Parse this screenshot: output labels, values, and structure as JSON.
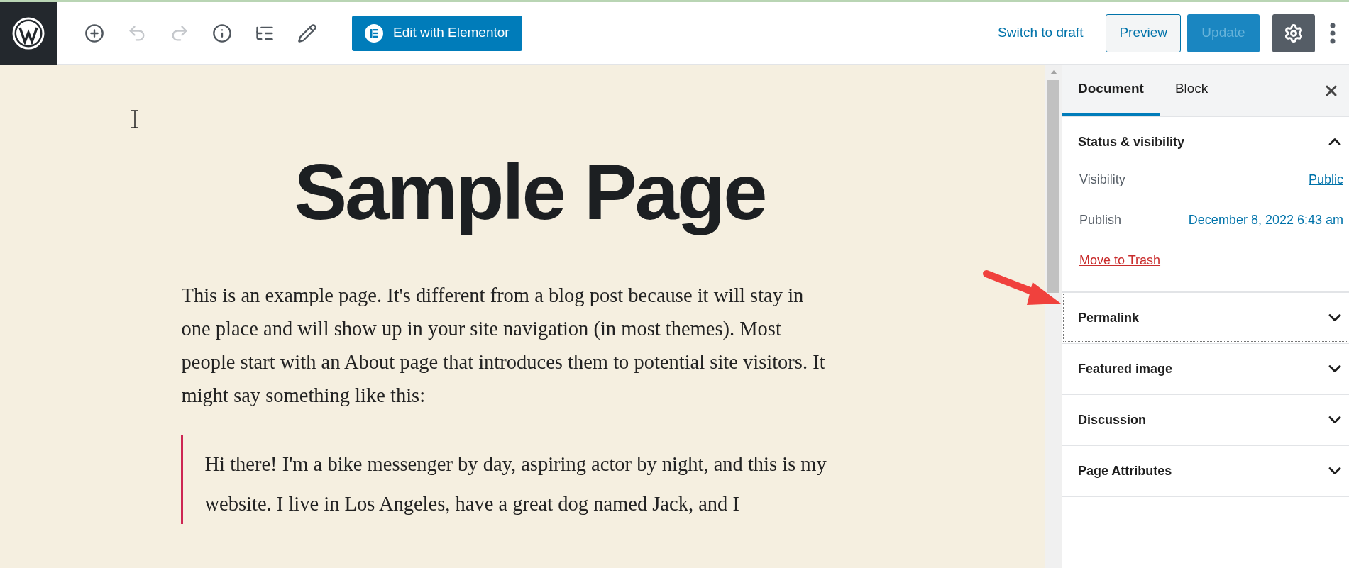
{
  "toolbar": {
    "tools": [
      {
        "kind": "add",
        "disabled": false
      },
      {
        "kind": "undo",
        "disabled": true
      },
      {
        "kind": "redo",
        "disabled": true
      },
      {
        "kind": "info",
        "disabled": false
      },
      {
        "kind": "outline",
        "disabled": false
      },
      {
        "kind": "edit",
        "disabled": false
      }
    ],
    "elementor_button": "Edit with Elementor",
    "switch_to_draft": "Switch to draft",
    "preview": "Preview",
    "update": {
      "label": "Update",
      "disabled": true
    },
    "settings": {
      "selected": true
    }
  },
  "editor": {
    "title": "Sample Page",
    "paragraph": "This is an example page. It's different from a blog post because it will stay in one place and will show up in your site navigation (in most themes). Most people start with an About page that introduces them to potential site visitors. It might say something like this:",
    "quote": "Hi there! I'm a bike messenger by day, aspiring actor by night, and this is my website. I live in Los Angeles, have a great dog named Jack, and I"
  },
  "sidebar": {
    "tabs": [
      {
        "label": "Document",
        "selected": true
      },
      {
        "label": "Block",
        "selected": false
      }
    ],
    "sections": [
      {
        "title": "Status & visibility",
        "expanded": true,
        "focused": false,
        "rows": [
          {
            "label": "Visibility",
            "value": "Public"
          },
          {
            "label": "Publish",
            "value": "December 8, 2022 6:43 am"
          }
        ],
        "trash": "Move to Trash"
      },
      {
        "title": "Permalink",
        "expanded": false,
        "focused": true
      },
      {
        "title": "Featured image",
        "expanded": false,
        "focused": false
      },
      {
        "title": "Discussion",
        "expanded": false,
        "focused": false
      },
      {
        "title": "Page Attributes",
        "expanded": false,
        "focused": false
      }
    ]
  }
}
